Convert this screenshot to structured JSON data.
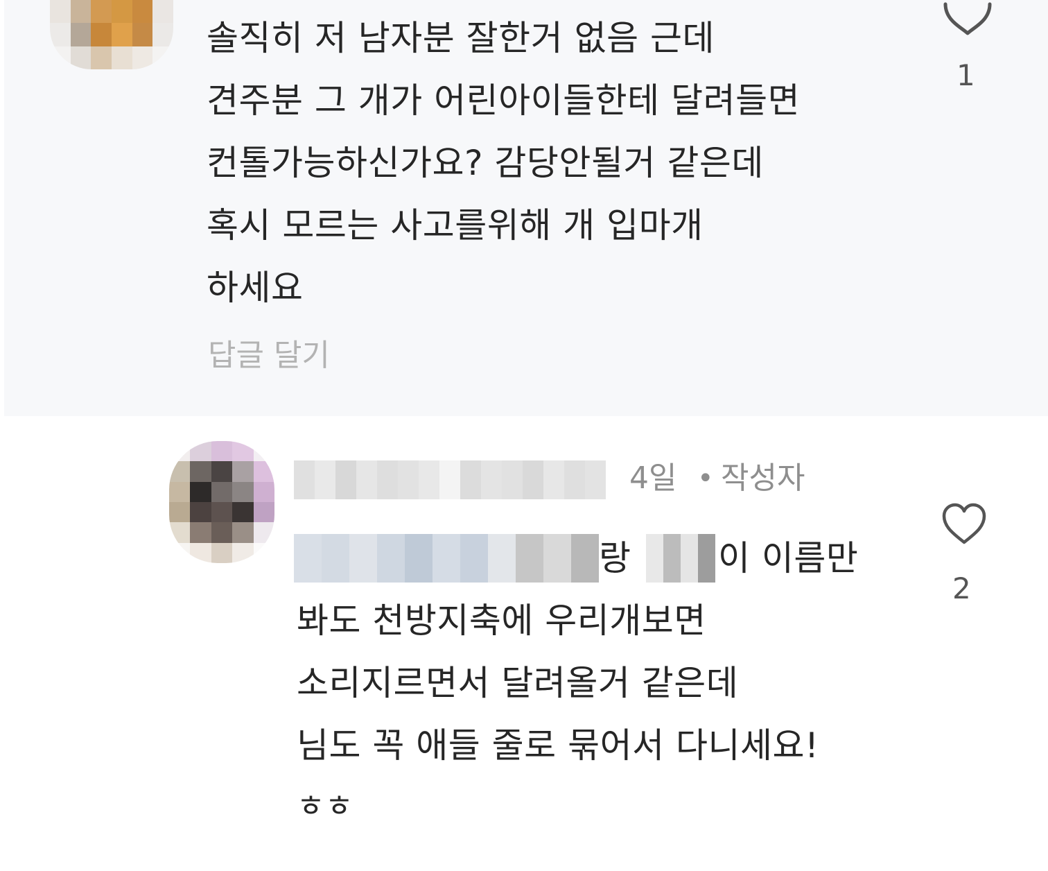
{
  "top_comment": {
    "lines": [
      "솔직히 저 남자분 잘한거 없음 근데",
      "견주분 그 개가 어린아이들한테 달려들면",
      "컨톨가능하신가요? 감당안될거 같은데",
      "혹시 모르는 사고를위해 개 입마개",
      "하세요"
    ],
    "reply_label": "답글 달기",
    "like_count": "1",
    "icon": "heart-outline-icon"
  },
  "reply_comment": {
    "time": "4일",
    "separator": "•",
    "author_badge": "작성자",
    "line1_part1": "랑",
    "line1_part2": "이 이름만",
    "lines": [
      "봐도 천방지축에 우리개보면",
      "소리지르면서 달려올거 같은데",
      "님도 꼭 애들 줄로 묶어서 다니세요!",
      "ㅎㅎ"
    ],
    "like_count": "2",
    "icon": "heart-outline-icon"
  },
  "colors": {
    "text": "#262626",
    "muted": "#8e8e8e",
    "reply_link": "#b3b3b3",
    "top_bg": "#f7f8fa"
  }
}
